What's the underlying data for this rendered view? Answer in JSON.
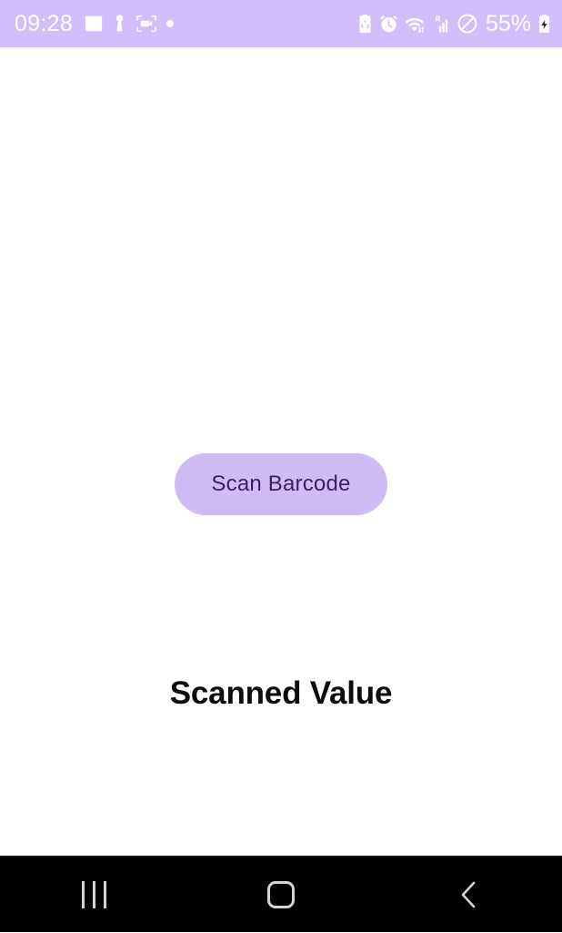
{
  "status_bar": {
    "time": "09:28",
    "battery_percent": "55%",
    "background_color": "#D1BEFA",
    "foreground_color": "#FFFFFF",
    "left_icons": [
      {
        "name": "image-icon",
        "label": "Screenshot / Gallery"
      },
      {
        "name": "person-icon",
        "label": "Profile"
      },
      {
        "name": "screen-recorder-icon",
        "label": "Screen recorder"
      },
      {
        "name": "dot-indicator-icon",
        "label": "Notification dot"
      }
    ],
    "right_icons": [
      {
        "name": "battery-saver-icon",
        "label": "Power saving"
      },
      {
        "name": "alarm-icon",
        "label": "Alarm set"
      },
      {
        "name": "wifi-icon",
        "label": "Wi-Fi transferring"
      },
      {
        "name": "roaming-signal-icon",
        "label": "R signal bars"
      },
      {
        "name": "do-not-disturb-icon",
        "label": "Do not disturb"
      },
      {
        "name": "battery-charging-icon",
        "label": "Battery charging"
      }
    ]
  },
  "app": {
    "background_color": "#FFFFFF",
    "scan_button": {
      "label": "Scan Barcode",
      "background_color": "#D0BCF5",
      "text_color": "#3E1E63"
    },
    "scanned_value": {
      "heading": "Scanned Value",
      "value": "",
      "text_color": "#0D0D0D"
    }
  },
  "nav_bar": {
    "background_color": "#000000",
    "icon_color": "#D4D4D4",
    "buttons": [
      {
        "name": "recents-button",
        "label": "Recents"
      },
      {
        "name": "home-button",
        "label": "Home"
      },
      {
        "name": "back-button",
        "label": "Back"
      }
    ]
  }
}
